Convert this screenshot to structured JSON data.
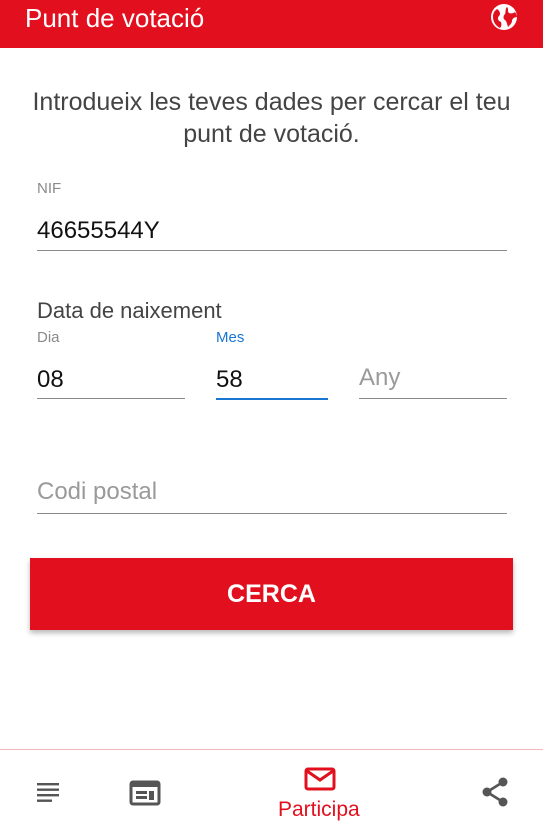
{
  "appbar": {
    "title": "Punt de votació",
    "globe_icon": "globe-icon",
    "color": "#e2101e"
  },
  "intro": {
    "text": "Introdueix les teves dades per cercar el teu punt de votació."
  },
  "nif": {
    "label": "NIF",
    "value": "46655544Y"
  },
  "birthdate": {
    "title": "Data de naixement",
    "day": {
      "label": "Dia",
      "value": "08"
    },
    "month": {
      "label": "Mes",
      "value": "58"
    },
    "year": {
      "placeholder": "Any",
      "value": ""
    }
  },
  "postal": {
    "placeholder": "Codi postal",
    "value": ""
  },
  "search_button": {
    "label": "CERCA"
  },
  "bottom_nav": {
    "items": [
      {
        "icon": "list-icon",
        "label": ""
      },
      {
        "icon": "web-page-icon",
        "label": ""
      },
      {
        "icon": "mail-icon",
        "label": "Participa",
        "selected": true
      },
      {
        "icon": "share-icon",
        "label": ""
      }
    ],
    "active_color": "#e2101e"
  },
  "colors": {
    "accent": "#e2101e",
    "focus": "#1976d2"
  }
}
